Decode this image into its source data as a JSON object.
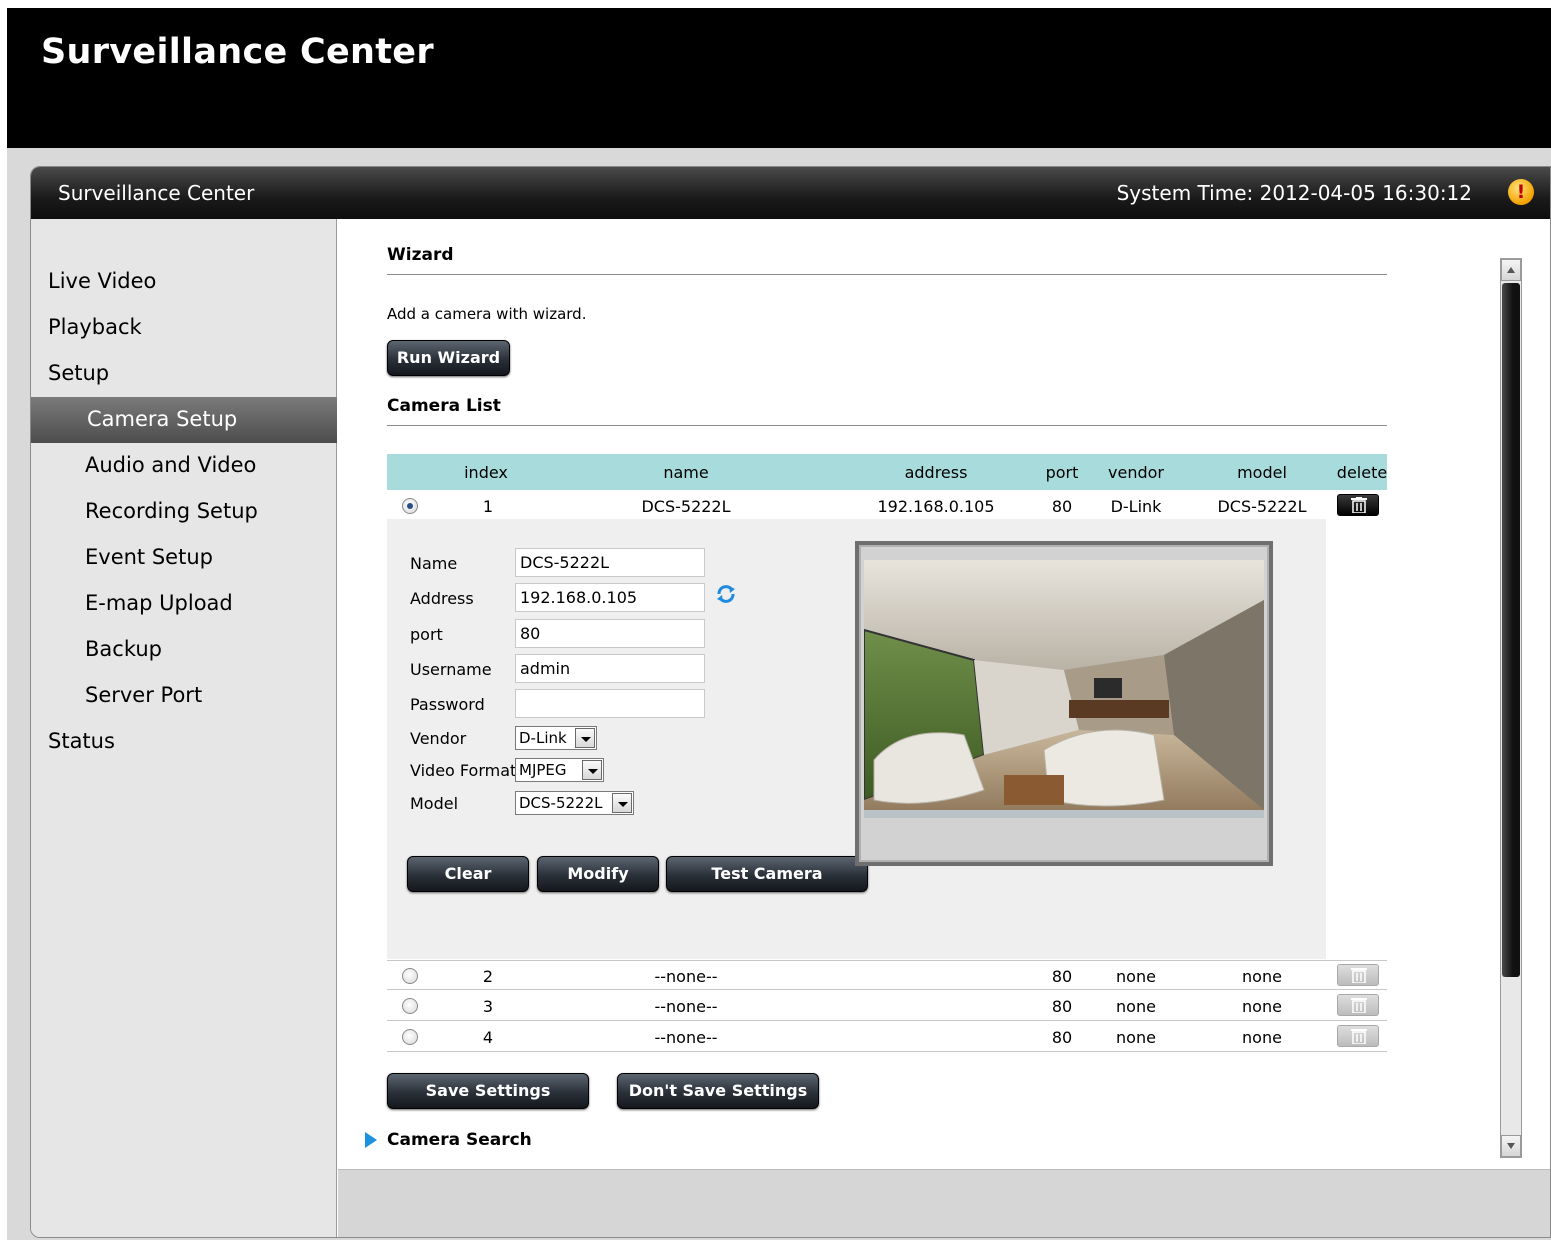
{
  "banner": {
    "title": "Surveillance Center"
  },
  "titlebar": {
    "app_name": "Surveillance Center",
    "system_time": "System Time: 2012-04-05 16:30:12"
  },
  "sidebar": {
    "items": [
      {
        "label": "Live Video"
      },
      {
        "label": "Playback"
      },
      {
        "label": "Setup"
      },
      {
        "label": "Status"
      }
    ],
    "sub_items": [
      {
        "label": "Camera Setup",
        "active": true
      },
      {
        "label": "Audio and Video"
      },
      {
        "label": "Recording Setup"
      },
      {
        "label": "Event Setup"
      },
      {
        "label": "E-map Upload"
      },
      {
        "label": "Backup"
      },
      {
        "label": "Server Port"
      }
    ]
  },
  "wizard": {
    "title": "Wizard",
    "description": "Add a camera with wizard.",
    "run_button": "Run Wizard"
  },
  "camera_list": {
    "title": "Camera List",
    "columns": [
      "index",
      "name",
      "address",
      "port",
      "vendor",
      "model",
      "delete"
    ],
    "rows": [
      {
        "index": "1",
        "name": "DCS-5222L",
        "address": "192.168.0.105",
        "port": "80",
        "vendor": "D-Link",
        "model": "DCS-5222L",
        "selected": true
      },
      {
        "index": "2",
        "name": "--none--",
        "address": "",
        "port": "80",
        "vendor": "none",
        "model": "none",
        "selected": false
      },
      {
        "index": "3",
        "name": "--none--",
        "address": "",
        "port": "80",
        "vendor": "none",
        "model": "none",
        "selected": false
      },
      {
        "index": "4",
        "name": "--none--",
        "address": "",
        "port": "80",
        "vendor": "none",
        "model": "none",
        "selected": false
      }
    ]
  },
  "edit_form": {
    "labels": {
      "name": "Name",
      "address": "Address",
      "port": "port",
      "username": "Username",
      "password": "Password",
      "vendor": "Vendor",
      "video_format": "Video Format",
      "model": "Model"
    },
    "values": {
      "name": "DCS-5222L",
      "address": "192.168.0.105",
      "port": "80",
      "username": "admin",
      "password": "",
      "vendor": "D-Link",
      "video_format": "MJPEG",
      "model": "DCS-5222L"
    },
    "buttons": {
      "clear": "Clear",
      "modify": "Modify",
      "test": "Test Camera"
    }
  },
  "footer_buttons": {
    "save": "Save Settings",
    "dont_save": "Don't Save Settings"
  },
  "camera_search": {
    "label": "Camera Search"
  },
  "colors": {
    "table_header": "#a8dcdc",
    "accent_arrow": "#1e90e0",
    "banner": "#000000"
  }
}
